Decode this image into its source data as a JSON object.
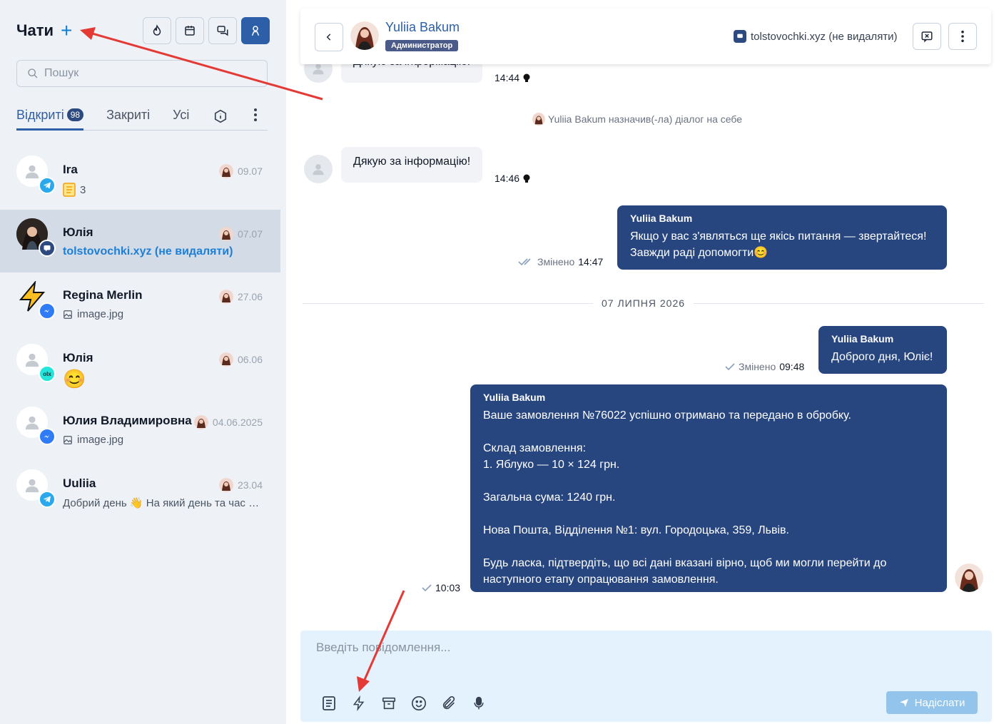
{
  "sidebar": {
    "title": "Чати",
    "search_placeholder": "Пошук",
    "tabs": [
      {
        "label": "Відкриті",
        "badge": "98"
      },
      {
        "label": "Закриті"
      },
      {
        "label": "Усі"
      }
    ],
    "chats": [
      {
        "name": "Ira",
        "date": "09.07",
        "preview": "3",
        "channel": "telegram"
      },
      {
        "name": "Юлія",
        "date": "07.07",
        "preview": "tolstovochki.xyz (не видаляти)",
        "channel": "site-chat"
      },
      {
        "name": "Regina Merlin",
        "date": "27.06",
        "preview": "image.jpg",
        "channel": "messenger"
      },
      {
        "name": "Юлія",
        "date": "06.06",
        "preview": "😊",
        "channel": "olx"
      },
      {
        "name": "Юлия Владимировна",
        "date": "04.06.2025",
        "preview": "image.jpg",
        "channel": "messenger"
      },
      {
        "name": "Uuliia",
        "date": "23.04",
        "preview": "Добрий день 👋 На який день та час …",
        "channel": "telegram"
      }
    ]
  },
  "header": {
    "name": "Yuliia Bakum",
    "role": "Администратор",
    "channel": "tolstovochki.xyz (не видаляти)"
  },
  "messages": {
    "partial_in_text": "Дякую за інформацію!",
    "partial_in_time": "14:44",
    "system_text": "Yuliia Bakum назначив(-ла) діалог на себе",
    "in_text": "Дякую за інформацію!",
    "in_time": "14:46",
    "out1": {
      "sender": "Yuliia Bakum",
      "body": "Якщо у вас з'являться ще якісь питання — звертайтеся!\nЗавжди раді допомогти😊",
      "edited": "Змінено",
      "time": "14:47"
    },
    "date_divider": "07 ЛИПНЯ 2026",
    "out2": {
      "sender": "Yuliia Bakum",
      "body": "Доброго дня, Юліє!",
      "edited": "Змінено",
      "time": "09:48"
    },
    "out3": {
      "sender": "Yuliia Bakum",
      "body": "Ваше замовлення №76022 успішно отримано та передано в обробку.\n\nСклад замовлення:\n1. Яблуко — 10 × 124 грн.\n\nЗагальна сума: 1240 грн.\n\nНова Пошта, Відділення №1: вул. Городоцька, 359, Львів.\n\nБудь ласка, підтвердіть, що всі дані вказані вірно, щоб ми могли перейти до\nнаступного етапу опрацювання замовлення.",
      "time": "10:03"
    }
  },
  "composer": {
    "placeholder": "Введіть повідомлення...",
    "send_label": "Надіслати"
  },
  "colors": {
    "accent": "#2c5fa8",
    "outgoing_bubble": "#27467f",
    "annotation_arrow": "#e53935"
  }
}
